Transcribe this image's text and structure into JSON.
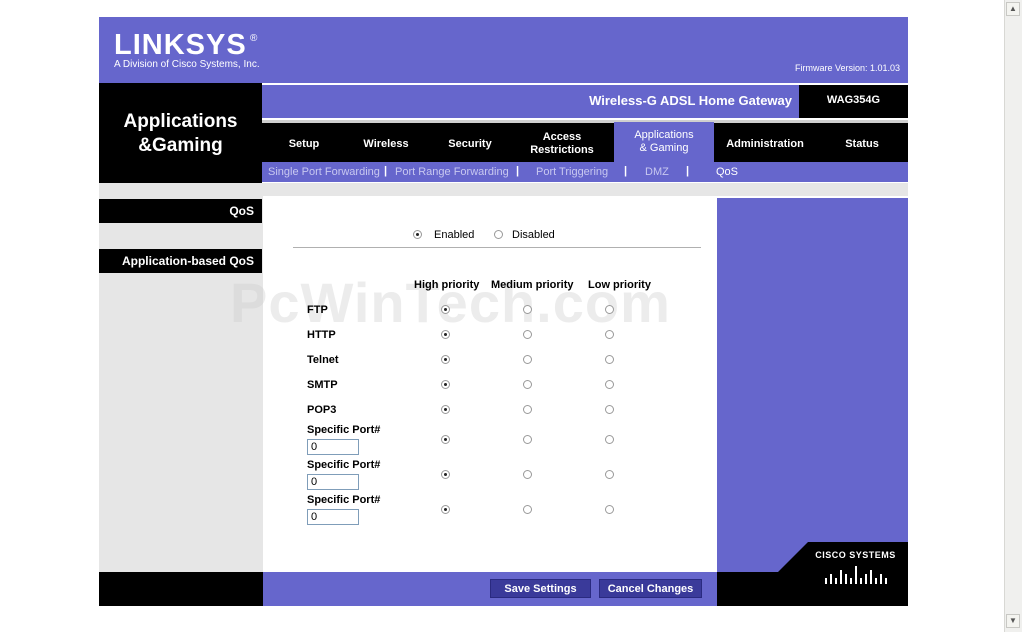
{
  "brand": {
    "logo": "LINKSYS",
    "logo_mark": "®",
    "tagline": "A Division of Cisco Systems, Inc.",
    "firmware": "Firmware Version: 1.01.03"
  },
  "product": {
    "name": "Wireless-G ADSL Home Gateway",
    "model": "WAG354G"
  },
  "section": {
    "line1": "Applications",
    "line2": "&Gaming"
  },
  "tabs": [
    {
      "label": "Setup"
    },
    {
      "label": "Wireless"
    },
    {
      "label": "Security"
    },
    {
      "label_line1": "Access",
      "label_line2": "Restrictions"
    },
    {
      "label_line1": "Applications",
      "label_line2": "& Gaming",
      "active": true
    },
    {
      "label": "Administration"
    },
    {
      "label": "Status"
    }
  ],
  "subnav": {
    "items": [
      "Single Port Forwarding",
      "Port Range Forwarding",
      "Port Triggering",
      "DMZ",
      "QoS"
    ],
    "separator": "|",
    "active": "QoS"
  },
  "side": {
    "qos": "QoS",
    "app_qos": "Application-based QoS"
  },
  "qos": {
    "enabled_label": "Enabled",
    "disabled_label": "Disabled",
    "state": "enabled",
    "headers": {
      "high": "High priority",
      "medium": "Medium priority",
      "low": "Low priority"
    },
    "rows": [
      {
        "label": "FTP",
        "priority": "high"
      },
      {
        "label": "HTTP",
        "priority": "high"
      },
      {
        "label": "Telnet",
        "priority": "high"
      },
      {
        "label": "SMTP",
        "priority": "high"
      },
      {
        "label": "POP3",
        "priority": "high"
      },
      {
        "label": "Specific Port#",
        "port": "0",
        "priority": "high"
      },
      {
        "label": "Specific Port#",
        "port": "0",
        "priority": "high"
      },
      {
        "label": "Specific Port#",
        "port": "0",
        "priority": "high"
      }
    ]
  },
  "buttons": {
    "save": "Save Settings",
    "cancel": "Cancel Changes"
  },
  "footer": {
    "cisco": "CISCO SYSTEMS"
  },
  "watermark": "PcWinTech.com",
  "scrollbar": {
    "up": "▲",
    "down": "▼"
  }
}
